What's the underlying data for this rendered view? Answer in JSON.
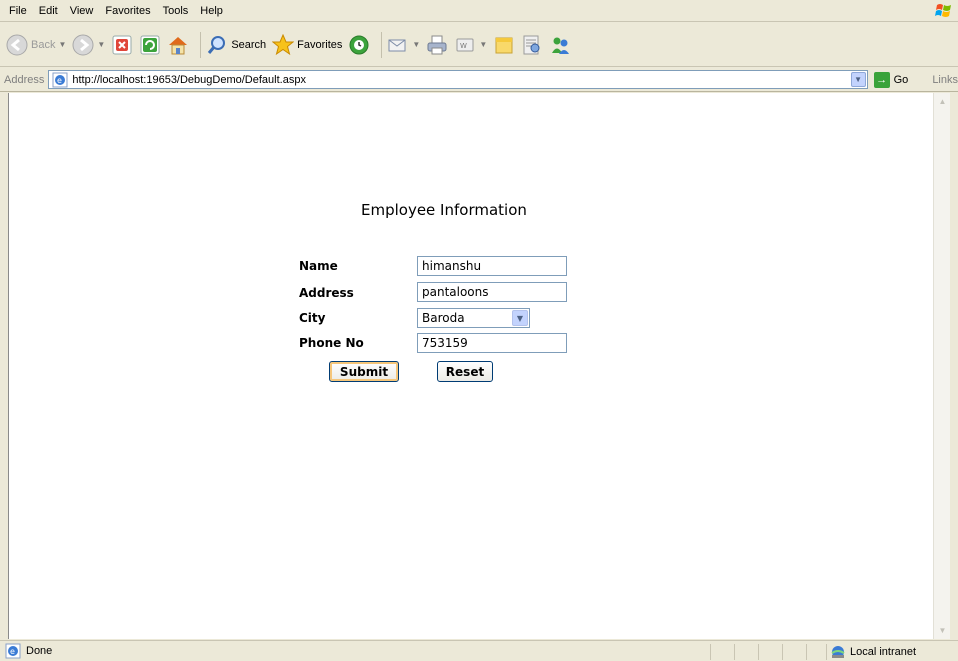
{
  "menubar": {
    "items": [
      "File",
      "Edit",
      "View",
      "Favorites",
      "Tools",
      "Help"
    ]
  },
  "toolbar": {
    "back_label": "Back",
    "search_label": "Search",
    "favorites_label": "Favorites"
  },
  "address": {
    "label": "Address",
    "url": "http://localhost:19653/DebugDemo/Default.aspx",
    "go_label": "Go",
    "links_label": "Links"
  },
  "page": {
    "title": "Employee Information",
    "fields": {
      "name_label": "Name",
      "name_value": "himanshu",
      "address_label": "Address",
      "address_value": "pantaloons",
      "city_label": "City",
      "city_value": "Baroda",
      "phone_label": "Phone No",
      "phone_value": "753159"
    },
    "submit_label": "Submit",
    "reset_label": "Reset"
  },
  "status": {
    "text": "Done",
    "zone": "Local intranet"
  },
  "colors": {
    "chrome": "#ece9d8",
    "input_border": "#7f9db9",
    "button_border": "#003c74",
    "go_green": "#3aa33a"
  }
}
